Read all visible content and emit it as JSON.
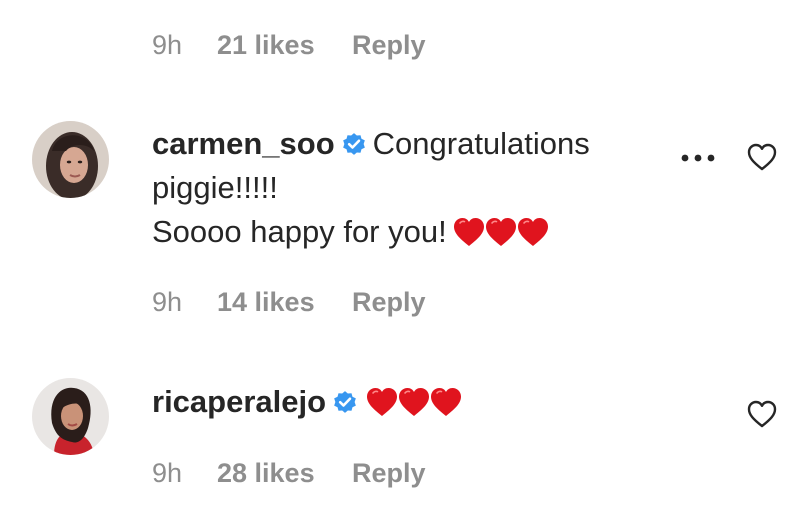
{
  "top_meta": {
    "time": "9h",
    "likes": "21 likes",
    "reply": "Reply"
  },
  "comments": [
    {
      "username": "carmen_soo",
      "text_line1": "Congratulations",
      "text_line2": "piggie!!!!!",
      "text_line3": "Soooo happy for you!",
      "emoji": "❤️❤️❤️",
      "time": "9h",
      "likes": "14 likes",
      "reply": "Reply",
      "verified": true
    },
    {
      "username": "ricaperalejo",
      "emoji": "❤️❤️❤️",
      "time": "9h",
      "likes": "28 likes",
      "reply": "Reply",
      "verified": true
    }
  ],
  "colors": {
    "text": "#262626",
    "secondary": "#8e8e8e",
    "verified_badge": "#3897f0",
    "heart_emoji": "#e0141e"
  },
  "icons": {
    "verified": "verified-badge-icon",
    "more": "more-options-icon",
    "like": "heart-outline-icon"
  }
}
